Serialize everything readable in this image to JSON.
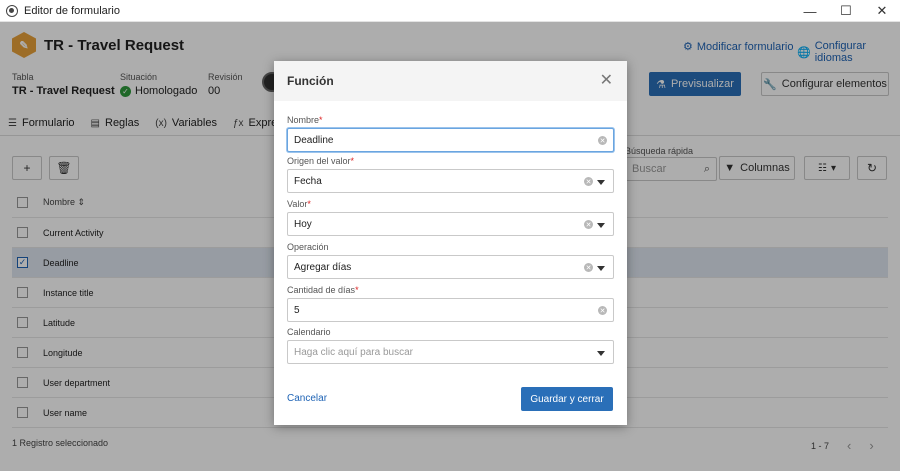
{
  "window": {
    "title": "Editor de formulario",
    "controls": [
      "—",
      "☐",
      "✕"
    ]
  },
  "header": {
    "form_title": "TR - Travel Request",
    "modify_link": "Modificar formulario",
    "languages_link": "Configurar idiomas"
  },
  "info": {
    "table_label": "Tabla",
    "table_value": "TR - Travel Request",
    "status_label": "Situación",
    "status_value": "Homologado",
    "revision_label": "Revisión",
    "revision_value": "00"
  },
  "actions": {
    "preview": "Previsualizar",
    "configure_elements": "Configurar elementos"
  },
  "tabs": [
    {
      "icon": "list-icon",
      "label": "Formulario"
    },
    {
      "icon": "rules-icon",
      "label": "Reglas"
    },
    {
      "icon": "variables-icon",
      "label": "Variables"
    },
    {
      "icon": "function-icon",
      "label": "Expresiones"
    }
  ],
  "list": {
    "quick_search_label": "Búsqueda rápida",
    "quick_search_placeholder": "Buscar",
    "columns_label": "Columnas",
    "name_header": "Nombre",
    "rows": [
      {
        "name": "Current Activity",
        "checked": false
      },
      {
        "name": "Deadline",
        "checked": true
      },
      {
        "name": "Instance title",
        "checked": false
      },
      {
        "name": "Latitude",
        "checked": false
      },
      {
        "name": "Longitude",
        "checked": false
      },
      {
        "name": "User department",
        "checked": false
      },
      {
        "name": "User name",
        "checked": false
      }
    ],
    "selected_count": "1 Registro seleccionado",
    "pagination": "1 - 7"
  },
  "modal": {
    "title": "Función",
    "fields": {
      "nombre": {
        "label": "Nombre",
        "value": "Deadline"
      },
      "origen": {
        "label": "Origen del valor",
        "value": "Fecha"
      },
      "valor": {
        "label": "Valor",
        "value": "Hoy"
      },
      "operacion": {
        "label": "Operación",
        "value": "Agregar días"
      },
      "cantidad": {
        "label": "Cantidad de días",
        "value": "5"
      },
      "calendario": {
        "label": "Calendario",
        "placeholder": "Haga clic aquí para buscar"
      }
    },
    "cancel": "Cancelar",
    "save": "Guardar y cerrar"
  },
  "colors": {
    "primary": "#2a6fb8",
    "link": "#1e63b5",
    "status_ok": "#2e9a3c",
    "form_icon": "#e8a13a"
  }
}
